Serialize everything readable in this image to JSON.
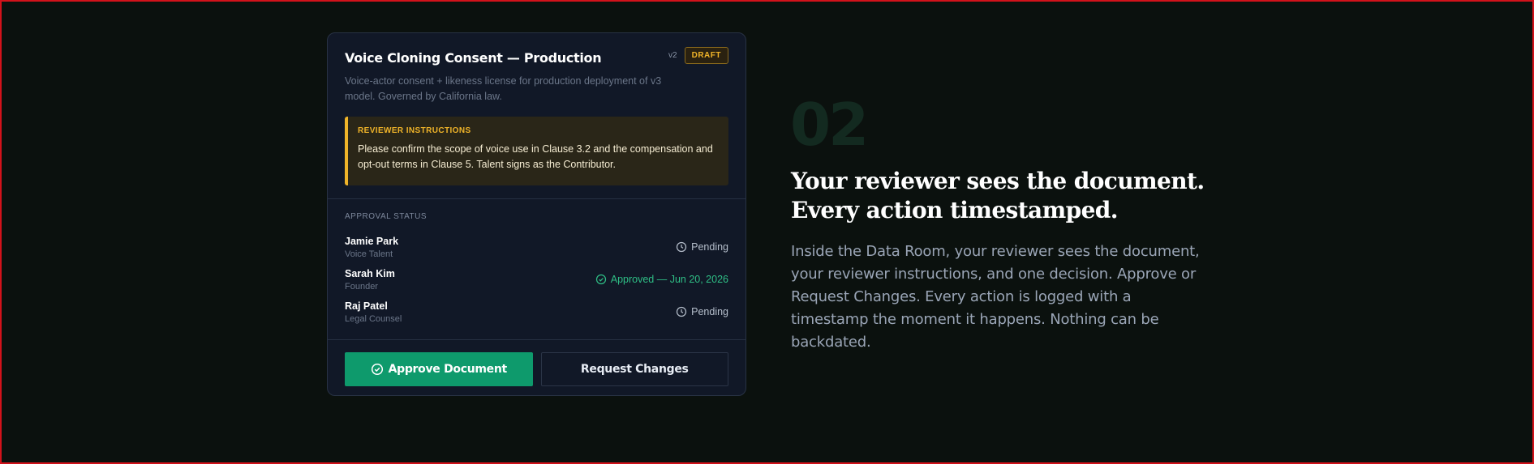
{
  "card": {
    "title": "Voice Cloning Consent — Production",
    "version": "v2",
    "status_badge": "DRAFT",
    "description": "Voice-actor consent + likeness license for production deployment of v3 model. Governed by California law.",
    "instructions": {
      "label": "REVIEWER INSTRUCTIONS",
      "text": "Please confirm the scope of voice use in Clause 3.2 and the compensation and opt-out terms in Clause 5. Talent signs as the Contributor."
    },
    "approval": {
      "label": "APPROVAL STATUS",
      "rows": [
        {
          "name": "Jamie Park",
          "role": "Voice Talent",
          "status": "Pending",
          "icon": "clock-icon"
        },
        {
          "name": "Sarah Kim",
          "role": "Founder",
          "status": "Approved — Jun 20, 2026",
          "icon": "check-circle-icon"
        },
        {
          "name": "Raj Patel",
          "role": "Legal Counsel",
          "status": "Pending",
          "icon": "clock-icon"
        }
      ]
    },
    "actions": {
      "approve_label": "Approve Document",
      "request_label": "Request Changes"
    }
  },
  "feature": {
    "step_number": "02",
    "headline_line1": "Your reviewer sees the document.",
    "headline_line2": "Every action timestamped.",
    "body": "Inside the Data Room, your reviewer sees the document, your reviewer instructions, and one decision. Approve or Request Changes. Every action is logged with a timestamp the moment it happens. Nothing can be backdated."
  },
  "colors": {
    "background": "#0b110e",
    "card": "#111827",
    "accent_green": "#0e9a6c",
    "approved_text": "#2fbf86",
    "draft_yellow": "#f0b429",
    "frame_border": "#d2121b"
  }
}
